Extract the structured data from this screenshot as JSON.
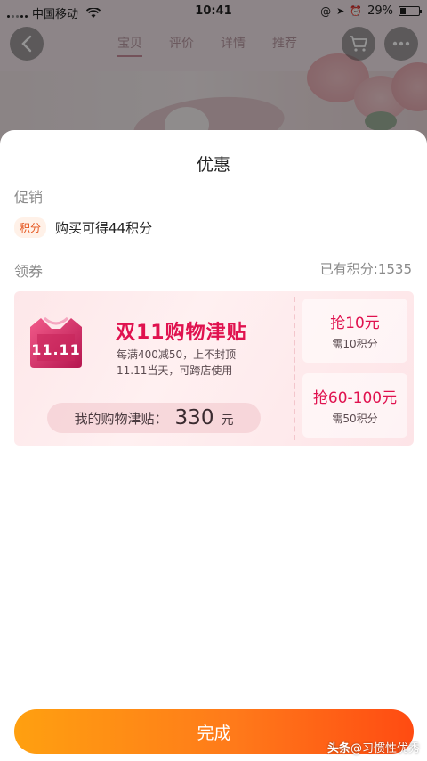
{
  "status_bar": {
    "carrier": "中国移动",
    "time": "10:41",
    "battery": "29%",
    "battery_level": 0.29
  },
  "background_nav": {
    "tabs": [
      "宝贝",
      "评价",
      "详情",
      "推荐"
    ]
  },
  "sheet": {
    "title": "优惠",
    "promotion_section_label": "促销",
    "promotion_tag": "积分",
    "promotion_text": "购买可得44积分",
    "coupon_section_label": "领券",
    "points_balance": "已有积分:1535"
  },
  "coupon": {
    "logo_text": "11.11",
    "title": "双11购物津贴",
    "desc_line1": "每满400减50，上不封顶",
    "desc_line2": "11.11当天，可跨店使用",
    "allowance_label": "我的购物津贴：",
    "allowance_value": "330",
    "allowance_unit": "元",
    "options": [
      {
        "main": "抢10元",
        "sub": "需10积分"
      },
      {
        "main": "抢60-100元",
        "sub": "需50积分"
      }
    ]
  },
  "done_label": "完成",
  "watermark": {
    "prefix": "头条",
    "suffix": "@习惯性优秀"
  },
  "colors": {
    "accent_red": "#e0124f",
    "button_gradient_start": "#ffa010",
    "button_gradient_end": "#ff4b12",
    "points_tag": "#e5561f"
  }
}
